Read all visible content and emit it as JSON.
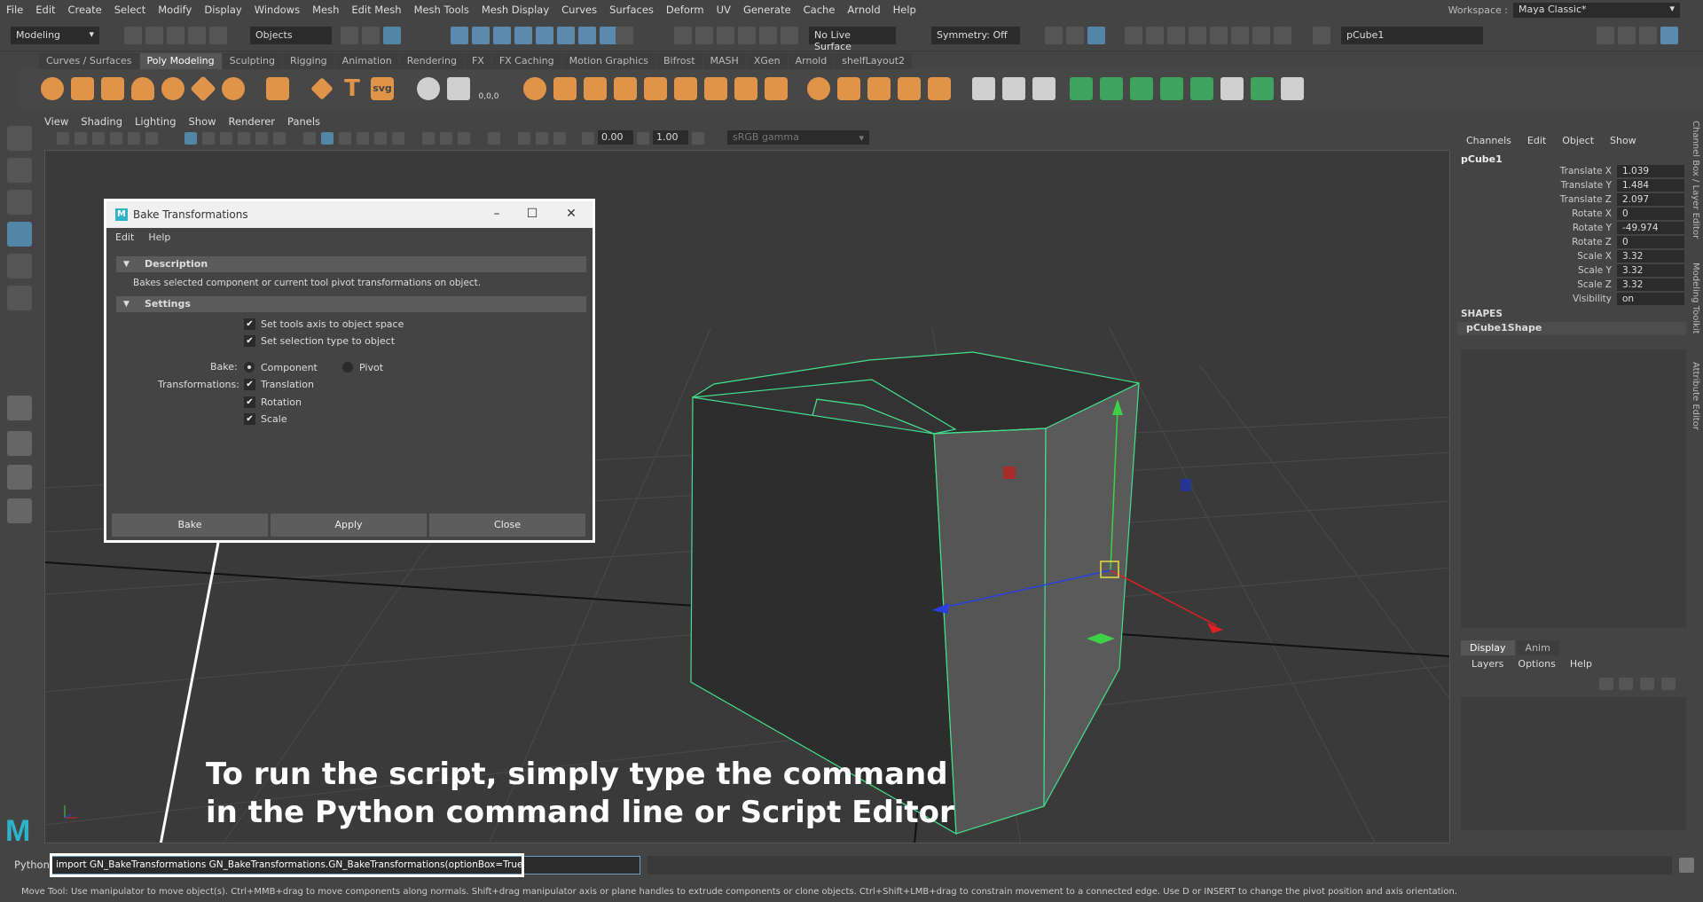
{
  "menubar": {
    "items": [
      "File",
      "Edit",
      "Create",
      "Select",
      "Modify",
      "Display",
      "Windows",
      "Mesh",
      "Edit Mesh",
      "Mesh Tools",
      "Mesh Display",
      "Curves",
      "Surfaces",
      "Deform",
      "UV",
      "Generate",
      "Cache",
      "Arnold",
      "Help"
    ],
    "workspace_label": "Workspace :",
    "workspace_value": "Maya Classic*"
  },
  "statusline": {
    "menuset": "Modeling",
    "selection_mode": "Objects",
    "live_surface": "No Live Surface",
    "symmetry": "Symmetry: Off",
    "object_name": "pCube1"
  },
  "shelf": {
    "tabs": [
      "Curves / Surfaces",
      "Poly Modeling",
      "Sculpting",
      "Rigging",
      "Animation",
      "Rendering",
      "FX",
      "FX Caching",
      "Motion Graphics",
      "Bifrost",
      "MASH",
      "XGen",
      "Arnold",
      "shelfLayout2"
    ],
    "active_tab": "Poly Modeling",
    "text_icon": "T",
    "svg_icon": "svg",
    "sweep_label": "0,0,0"
  },
  "viewport": {
    "menu": [
      "View",
      "Shading",
      "Lighting",
      "Show",
      "Renderer",
      "Panels"
    ],
    "exposure": "0.00",
    "gamma": "1.00",
    "color_space": "sRGB gamma"
  },
  "dialog": {
    "title": "Bake Transformations",
    "menu": [
      "Edit",
      "Help"
    ],
    "description_header": "Description",
    "description_text": "Bakes selected component or current tool pivot transformations on object.",
    "settings_header": "Settings",
    "opt_tools_axis": "Set tools axis to object space",
    "opt_selection_type": "Set selection type to object",
    "bake_label": "Bake:",
    "bake_component": "Component",
    "bake_pivot": "Pivot",
    "transformations_label": "Transformations:",
    "trans_translation": "Translation",
    "trans_rotation": "Rotation",
    "trans_scale": "Scale",
    "btn_bake": "Bake",
    "btn_apply": "Apply",
    "btn_close": "Close"
  },
  "channelbox": {
    "menu": [
      "Channels",
      "Edit",
      "Object",
      "Show"
    ],
    "object": "pCube1",
    "attributes": [
      {
        "name": "Translate X",
        "value": "1.039"
      },
      {
        "name": "Translate Y",
        "value": "1.484"
      },
      {
        "name": "Translate Z",
        "value": "2.097"
      },
      {
        "name": "Rotate X",
        "value": "0"
      },
      {
        "name": "Rotate Y",
        "value": "-49.974"
      },
      {
        "name": "Rotate Z",
        "value": "0"
      },
      {
        "name": "Scale X",
        "value": "3.32"
      },
      {
        "name": "Scale Y",
        "value": "3.32"
      },
      {
        "name": "Scale Z",
        "value": "3.32"
      },
      {
        "name": "Visibility",
        "value": "on"
      }
    ],
    "shapes_header": "SHAPES",
    "shape_name": "pCube1Shape"
  },
  "layereditor": {
    "tabs": [
      "Display",
      "Anim"
    ],
    "active_tab": "Display",
    "menu": [
      "Layers",
      "Options",
      "Help"
    ]
  },
  "sidetabs": [
    "Channel Box / Layer Editor",
    "Modeling Toolkit",
    "Attribute Editor"
  ],
  "commandline": {
    "label": "Python",
    "value": "import GN_BakeTransformations GN_BakeTransformations.GN_BakeTransformations(optionBox=True)"
  },
  "helpline": "Move Tool: Use manipulator to move object(s). Ctrl+MMB+drag to move components along normals. Shift+drag manipulator axis or plane handles to extrude components or clone objects. Ctrl+Shift+LMB+drag to constrain movement to a connected edge. Use D or INSERT to change the pivot position and axis orientation.",
  "caption": {
    "line1": "To run the script, simply type the command",
    "line2": "in the Python command line or Script Editor"
  },
  "colors": {
    "accent": "#5285a6",
    "shelf_orange": "#e0944a",
    "shelf_green": "#3ea35d",
    "wireframe": "#44e08a",
    "logo": "#2fb3c8"
  }
}
